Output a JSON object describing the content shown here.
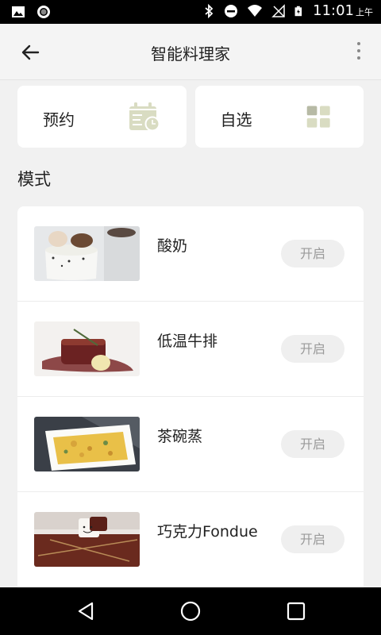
{
  "status_bar": {
    "time": "11:01",
    "ampm": "上午"
  },
  "app_bar": {
    "title": "智能料理家"
  },
  "top_cards": [
    {
      "label": "预约",
      "icon": "calendar-clock-icon"
    },
    {
      "label": "自选",
      "icon": "grid-icon"
    }
  ],
  "section_title": "模式",
  "modes": [
    {
      "name": "酸奶",
      "button": "开启",
      "image": "yogurt-photo"
    },
    {
      "name": "低温牛排",
      "button": "开启",
      "image": "steak-photo"
    },
    {
      "name": "茶碗蒸",
      "button": "开启",
      "image": "egg-custard-photo"
    },
    {
      "name": "巧克力Fondue",
      "button": "开启",
      "image": "chocolate-fondue-photo"
    }
  ],
  "colors": {
    "icon_accent": "#d9dcc2",
    "button_bg": "#efefef",
    "button_text": "#9a9a9a"
  }
}
